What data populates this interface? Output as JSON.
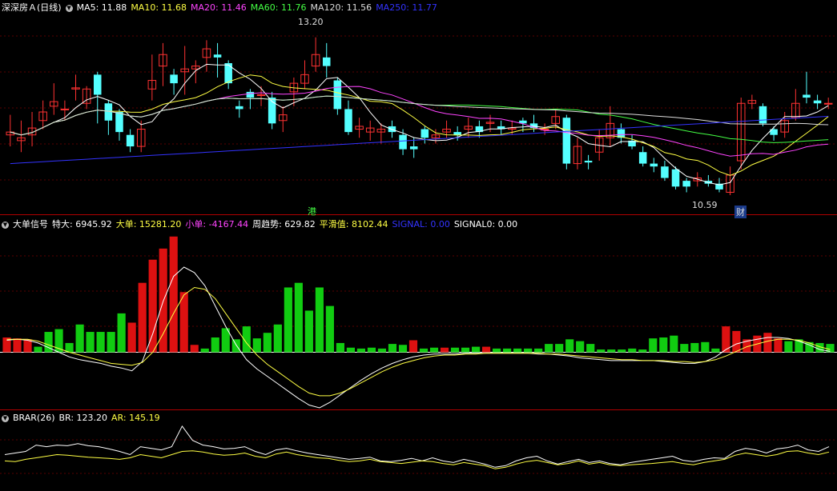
{
  "main": {
    "title": "深深房Ａ(日线)",
    "ma": [
      {
        "label": "MA5: 11.88",
        "color": "#ffffff"
      },
      {
        "label": "MA10: 11.68",
        "color": "#ffff44"
      },
      {
        "label": "MA20: 11.46",
        "color": "#ff44ff"
      },
      {
        "label": "MA60: 11.76",
        "color": "#44ff44"
      },
      {
        "label": "MA120: 11.56",
        "color": "#dddddd"
      },
      {
        "label": "MA250: 11.77",
        "color": "#3333ff"
      }
    ],
    "high_label": "13.20",
    "low_label": "10.59",
    "marker_gang": "港",
    "marker_cai": "财",
    "price_range": [
      10.2,
      13.6
    ],
    "candles": [
      [
        11.5,
        11.55,
        11.85,
        11.3
      ],
      [
        11.4,
        11.45,
        11.75,
        11.2
      ],
      [
        11.5,
        11.62,
        11.9,
        11.3
      ],
      [
        11.75,
        11.9,
        12.1,
        11.6
      ],
      [
        12.0,
        12.08,
        12.4,
        11.85
      ],
      [
        11.95,
        11.95,
        12.1,
        11.75
      ],
      [
        12.3,
        12.32,
        12.55,
        12.1
      ],
      [
        12.05,
        12.3,
        12.35,
        11.95
      ],
      [
        12.55,
        12.2,
        12.6,
        11.7
      ],
      [
        12.05,
        11.75,
        12.1,
        11.5
      ],
      [
        11.9,
        11.55,
        11.95,
        11.4
      ],
      [
        11.5,
        11.3,
        11.6,
        11.2
      ],
      [
        11.3,
        11.6,
        11.75,
        11.2
      ],
      [
        12.3,
        12.45,
        12.9,
        12.1
      ],
      [
        12.7,
        12.9,
        13.1,
        12.35
      ],
      [
        12.55,
        12.4,
        12.65,
        12.2
      ],
      [
        12.6,
        12.65,
        13.05,
        12.2
      ],
      [
        12.65,
        12.7,
        12.8,
        12.4
      ],
      [
        12.85,
        13.0,
        13.15,
        12.6
      ],
      [
        12.9,
        12.85,
        13.1,
        12.5
      ],
      [
        12.75,
        12.4,
        12.8,
        12.3
      ],
      [
        12.0,
        11.95,
        12.1,
        11.8
      ],
      [
        12.25,
        12.15,
        12.3,
        11.95
      ],
      [
        12.2,
        12.2,
        12.35,
        12.0
      ],
      [
        12.15,
        11.7,
        12.25,
        11.6
      ],
      [
        11.75,
        11.85,
        12.0,
        11.55
      ],
      [
        12.25,
        12.4,
        12.5,
        12.0
      ],
      [
        12.4,
        12.55,
        12.8,
        12.3
      ],
      [
        12.7,
        12.9,
        13.2,
        12.6
      ],
      [
        12.85,
        12.7,
        13.1,
        12.5
      ],
      [
        12.45,
        11.95,
        12.5,
        11.85
      ],
      [
        11.95,
        11.55,
        12.1,
        11.5
      ],
      [
        11.6,
        11.65,
        11.8,
        11.45
      ],
      [
        11.55,
        11.62,
        11.75,
        11.4
      ],
      [
        11.55,
        11.6,
        11.7,
        11.35
      ],
      [
        11.65,
        11.55,
        11.75,
        11.45
      ],
      [
        11.5,
        11.25,
        11.6,
        11.15
      ],
      [
        11.3,
        11.25,
        11.45,
        11.1
      ],
      [
        11.6,
        11.45,
        11.65,
        11.35
      ],
      [
        11.45,
        11.5,
        11.6,
        11.35
      ],
      [
        11.55,
        11.6,
        11.75,
        11.45
      ],
      [
        11.55,
        11.5,
        11.65,
        11.4
      ],
      [
        11.6,
        11.65,
        11.8,
        11.45
      ],
      [
        11.65,
        11.55,
        11.75,
        11.45
      ],
      [
        11.7,
        11.72,
        11.85,
        11.55
      ],
      [
        11.65,
        11.6,
        11.75,
        11.5
      ],
      [
        11.6,
        11.62,
        11.75,
        11.5
      ],
      [
        11.75,
        11.7,
        11.8,
        11.55
      ],
      [
        11.7,
        11.62,
        11.85,
        11.55
      ],
      [
        11.6,
        11.6,
        11.7,
        11.5
      ],
      [
        11.7,
        11.82,
        11.95,
        11.6
      ],
      [
        11.8,
        11.0,
        11.85,
        10.9
      ],
      [
        11.0,
        11.3,
        11.45,
        10.9
      ],
      [
        11.05,
        11.02,
        11.15,
        10.9
      ],
      [
        11.2,
        11.45,
        11.6,
        11.05
      ],
      [
        11.45,
        11.7,
        12.0,
        11.3
      ],
      [
        11.6,
        11.45,
        11.7,
        11.35
      ],
      [
        11.4,
        11.3,
        11.5,
        11.25
      ],
      [
        11.2,
        11.0,
        11.3,
        10.95
      ],
      [
        11.0,
        10.95,
        11.1,
        10.85
      ],
      [
        10.95,
        10.75,
        11.05,
        10.7
      ],
      [
        10.9,
        10.6,
        10.95,
        10.55
      ],
      [
        10.7,
        10.6,
        10.75,
        10.5
      ],
      [
        10.7,
        10.75,
        10.85,
        10.6
      ],
      [
        10.7,
        10.65,
        10.8,
        10.6
      ],
      [
        10.65,
        10.55,
        10.75,
        10.5
      ],
      [
        10.5,
        10.8,
        10.95,
        10.45
      ],
      [
        11.05,
        12.05,
        12.15,
        10.9
      ],
      [
        12.05,
        12.1,
        12.2,
        11.95
      ],
      [
        12.0,
        11.7,
        12.05,
        11.65
      ],
      [
        11.6,
        11.5,
        11.65,
        11.4
      ],
      [
        11.55,
        11.75,
        11.9,
        11.45
      ],
      [
        11.8,
        12.05,
        12.3,
        11.75
      ],
      [
        12.2,
        12.15,
        12.6,
        12.05
      ],
      [
        12.1,
        12.05,
        12.2,
        11.95
      ],
      [
        12.05,
        12.05,
        12.15,
        11.95
      ]
    ]
  },
  "big_order": {
    "title": "大单信号",
    "labels": [
      {
        "label": "特大: 6945.92",
        "color": "#ffffff"
      },
      {
        "label": "大单: 15281.20",
        "color": "#ffff44"
      },
      {
        "label": "小单: -4167.44",
        "color": "#ff44ff"
      },
      {
        "label": "周趋势: 629.82",
        "color": "#ffffff"
      },
      {
        "label": "平滑值: 8102.44",
        "color": "#ffff44"
      },
      {
        "label": "SIGNAL: 0.00",
        "color": "#3333ff"
      },
      {
        "label": "SIGNAL0: 0.00",
        "color": "#ffffff"
      }
    ],
    "range": [
      -60,
      130
    ],
    "bars": [
      [
        16,
        "r"
      ],
      [
        15,
        "r"
      ],
      [
        14,
        "r"
      ],
      [
        6,
        "g"
      ],
      [
        22,
        "g"
      ],
      [
        25,
        "g"
      ],
      [
        10,
        "g"
      ],
      [
        30,
        "g"
      ],
      [
        22,
        "g"
      ],
      [
        22,
        "g"
      ],
      [
        22,
        "g"
      ],
      [
        42,
        "g"
      ],
      [
        32,
        "r"
      ],
      [
        75,
        "r"
      ],
      [
        100,
        "r"
      ],
      [
        112,
        "r"
      ],
      [
        125,
        "r"
      ],
      [
        65,
        "r"
      ],
      [
        8,
        "r"
      ],
      [
        4,
        "g"
      ],
      [
        16,
        "g"
      ],
      [
        26,
        "g"
      ],
      [
        14,
        "g"
      ],
      [
        28,
        "g"
      ],
      [
        15,
        "g"
      ],
      [
        21,
        "g"
      ],
      [
        30,
        "g"
      ],
      [
        70,
        "g"
      ],
      [
        75,
        "g"
      ],
      [
        45,
        "g"
      ],
      [
        70,
        "g"
      ],
      [
        50,
        "g"
      ],
      [
        10,
        "g"
      ],
      [
        5,
        "g"
      ],
      [
        4,
        "g"
      ],
      [
        5,
        "g"
      ],
      [
        4,
        "g"
      ],
      [
        9,
        "g"
      ],
      [
        8,
        "g"
      ],
      [
        13,
        "r"
      ],
      [
        4,
        "g"
      ],
      [
        5,
        "g"
      ],
      [
        5,
        "r"
      ],
      [
        5,
        "g"
      ],
      [
        5,
        "g"
      ],
      [
        6,
        "g"
      ],
      [
        6,
        "r"
      ],
      [
        4,
        "g"
      ],
      [
        4,
        "g"
      ],
      [
        4,
        "g"
      ],
      [
        4,
        "g"
      ],
      [
        4,
        "g"
      ],
      [
        9,
        "g"
      ],
      [
        9,
        "g"
      ],
      [
        14,
        "g"
      ],
      [
        12,
        "g"
      ],
      [
        9,
        "g"
      ],
      [
        3,
        "g"
      ],
      [
        3,
        "g"
      ],
      [
        3,
        "g"
      ],
      [
        4,
        "g"
      ],
      [
        3,
        "g"
      ],
      [
        15,
        "g"
      ],
      [
        16,
        "g"
      ],
      [
        18,
        "g"
      ],
      [
        9,
        "g"
      ],
      [
        10,
        "g"
      ],
      [
        11,
        "g"
      ],
      [
        4,
        "g"
      ],
      [
        28,
        "r"
      ],
      [
        23,
        "r"
      ],
      [
        14,
        "r"
      ],
      [
        18,
        "r"
      ],
      [
        21,
        "r"
      ],
      [
        15,
        "r"
      ],
      [
        12,
        "g"
      ],
      [
        14,
        "g"
      ],
      [
        11,
        "g"
      ],
      [
        10,
        "g"
      ],
      [
        9,
        "g"
      ]
    ],
    "line_white": [
      13,
      14,
      13,
      10,
      5,
      0,
      -5,
      -8,
      -10,
      -12,
      -15,
      -17,
      -20,
      -10,
      20,
      55,
      82,
      92,
      86,
      72,
      50,
      28,
      8,
      -8,
      -18,
      -26,
      -34,
      -42,
      -50,
      -57,
      -60,
      -54,
      -46,
      -38,
      -30,
      -23,
      -17,
      -12,
      -8,
      -5,
      -3,
      -2,
      -2,
      -2,
      -1,
      -1,
      -1,
      -1,
      -1,
      -1,
      -1,
      -2,
      -2,
      -3,
      -4,
      -6,
      -7,
      -8,
      -9,
      -9,
      -9,
      -9,
      -9,
      -10,
      -11,
      -12,
      -12,
      -10,
      -5,
      3,
      9,
      12,
      14,
      16,
      16,
      15,
      12,
      8,
      3,
      1
    ],
    "line_yellow": [
      14,
      14,
      14,
      12,
      8,
      4,
      0,
      -3,
      -6,
      -9,
      -12,
      -13,
      -14,
      -11,
      0,
      20,
      42,
      62,
      70,
      68,
      58,
      42,
      26,
      10,
      -3,
      -13,
      -21,
      -29,
      -37,
      -44,
      -47,
      -47,
      -44,
      -39,
      -33,
      -27,
      -21,
      -16,
      -12,
      -9,
      -6,
      -4,
      -3,
      -3,
      -2,
      -2,
      -1,
      -1,
      -1,
      -1,
      -1,
      -1,
      -2,
      -2,
      -3,
      -4,
      -5,
      -6,
      -7,
      -8,
      -8,
      -9,
      -9,
      -9,
      -10,
      -10,
      -11,
      -10,
      -8,
      -4,
      1,
      6,
      9,
      12,
      14,
      14,
      13,
      10,
      6,
      3
    ]
  },
  "brar": {
    "title": "BRAR(26)",
    "labels": [
      {
        "label": "BR: 123.20",
        "color": "#ffffff"
      },
      {
        "label": "AR: 145.19",
        "color": "#ffff44"
      }
    ],
    "range": [
      40,
      260
    ],
    "br": [
      150,
      155,
      160,
      180,
      175,
      180,
      178,
      185,
      178,
      175,
      168,
      160,
      150,
      175,
      170,
      165,
      175,
      240,
      195,
      180,
      175,
      168,
      170,
      175,
      160,
      150,
      165,
      170,
      162,
      155,
      150,
      145,
      140,
      135,
      138,
      142,
      130,
      128,
      132,
      138,
      130,
      140,
      130,
      125,
      135,
      128,
      120,
      110,
      115,
      130,
      140,
      145,
      130,
      120,
      128,
      135,
      125,
      130,
      122,
      118,
      125,
      130,
      135,
      140,
      145,
      132,
      128,
      135,
      140,
      138,
      160,
      170,
      165,
      155,
      168,
      172,
      180,
      165,
      160,
      175
    ],
    "ar": [
      130,
      128,
      135,
      140,
      145,
      150,
      148,
      145,
      142,
      140,
      138,
      135,
      140,
      150,
      145,
      140,
      150,
      160,
      162,
      158,
      152,
      148,
      150,
      155,
      145,
      140,
      152,
      158,
      150,
      145,
      140,
      138,
      132,
      128,
      130,
      135,
      128,
      125,
      122,
      126,
      130,
      128,
      122,
      118,
      125,
      120,
      115,
      105,
      110,
      120,
      128,
      132,
      125,
      118,
      122,
      130,
      120,
      125,
      118,
      115,
      118,
      120,
      122,
      125,
      128,
      122,
      118,
      125,
      130,
      135,
      148,
      155,
      150,
      145,
      150,
      160,
      162,
      155,
      150,
      158
    ]
  }
}
